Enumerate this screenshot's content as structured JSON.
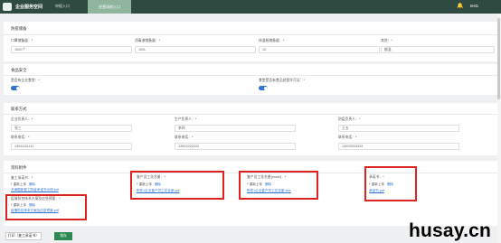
{
  "topbar": {
    "app_title": "企业服务空间",
    "nav_items": [
      "申报入口",
      "经营场地入口"
    ],
    "user_name": "test1"
  },
  "production": {
    "title": "防疫储备",
    "fields": [
      {
        "label": "口罩储备量：*",
        "value": "1000个"
      },
      {
        "label": "消毒液储备量：*",
        "value": "100L"
      },
      {
        "label": "体温枪储备量：*",
        "value": "10"
      },
      {
        "label": "其他：*",
        "value": "额温"
      }
    ]
  },
  "food_safety": {
    "title": "食品安全",
    "fields": [
      {
        "label": "是否有企业食堂：*",
        "on": true
      },
      {
        "label": "食堂是否有食品经营许可证：*",
        "on": true
      }
    ]
  },
  "contact": {
    "title": "联系方式",
    "row1": [
      {
        "label": "企业负责人：*",
        "value": "张三"
      },
      {
        "label": "生产负责人：*",
        "value": "李四"
      },
      {
        "label": "防疫负责人：*",
        "value": "王五"
      }
    ],
    "row2": [
      {
        "label": "联系电话：*",
        "value": "13911111111"
      },
      {
        "label": "联系电话：*",
        "value": "13922222222"
      },
      {
        "label": "联系电话：*",
        "value": "13933333333"
      }
    ]
  },
  "attachments": {
    "title": "资料附件",
    "upload_label": "重新上传",
    "delete_label": "删除",
    "items": [
      {
        "label": "复工承诺书：*",
        "file": "天津国新复工防疫承诺书示例.pdf"
      },
      {
        "label": "复产员工花名册：*",
        "file": "附件1企业复产员工花名册.pdf"
      },
      {
        "label": "复产员工花名册(excel)：*",
        "file": "附件1企业复产员工花名册.xlsx"
      },
      {
        "label": "承诺书：*",
        "file": "承诺书.pdf"
      },
      {
        "label": "疫情防控体系方案及应急预案：*",
        "file": "疫情防控体系方案及应急预案.pdf"
      }
    ]
  },
  "footer": {
    "print_label": "打印（复工承诺书）",
    "save_label": "保存"
  },
  "watermark": "husay.cn"
}
